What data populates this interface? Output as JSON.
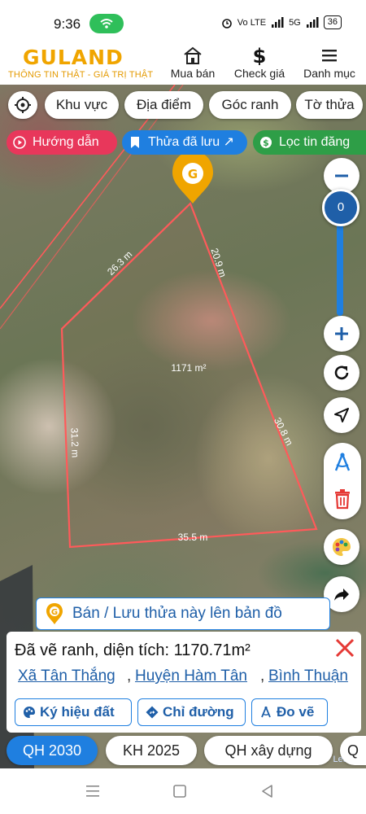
{
  "status_bar": {
    "time": "9:36",
    "network_label": "Vo LTE",
    "signal_label": "5G",
    "battery": "36"
  },
  "header": {
    "logo": "GULAND",
    "tagline": "THÔNG TIN THẬT - GIÁ TRỊ THẬT",
    "nav": [
      {
        "label": "Mua bán",
        "icon": "house-icon"
      },
      {
        "label": "Check giá",
        "icon": "dollar-icon"
      },
      {
        "label": "Danh mục",
        "icon": "menu-icon"
      }
    ]
  },
  "filters": {
    "row1": [
      "Khu vực",
      "Địa điểm",
      "Góc ranh",
      "Tờ thửa"
    ],
    "row2": [
      {
        "label": "Hướng dẫn",
        "color": "#e8375b",
        "icon": "play-circle-icon"
      },
      {
        "label": "Thửa đã lưu ↗",
        "color": "#1f7fe0",
        "icon": "bookmark-icon"
      },
      {
        "label": "Lọc tin đăng",
        "color": "#2e9e47",
        "icon": "dollar-circle-icon"
      }
    ]
  },
  "map": {
    "zoom_value": "0",
    "parcel_area": "1171 m²",
    "edges": [
      "26.3 m",
      "20.9 m",
      "30.8 m",
      "35.5 m",
      "31.2 m"
    ],
    "watermark": "Leaflet"
  },
  "save_banner": "Bán / Lưu thửa này lên bản đồ",
  "panel": {
    "title": "Đã vẽ ranh, diện tích: 1170.71m²",
    "location": [
      "Xã Tân Thắng",
      "Huyện Hàm Tân",
      "Bình Thuận"
    ],
    "separator": ",",
    "actions": [
      {
        "label": "Ký hiệu đất",
        "icon": "palette-icon"
      },
      {
        "label": "Chỉ đường",
        "icon": "directions-icon"
      },
      {
        "label": "Đo vẽ",
        "icon": "measure-icon"
      }
    ]
  },
  "layer_tabs": [
    "QH 2030",
    "KH 2025",
    "QH xây dựng",
    "Q"
  ],
  "colors": {
    "brand": "#f0a500",
    "accent": "#1f7fe0",
    "parcel_line": "#ff5a5a"
  }
}
